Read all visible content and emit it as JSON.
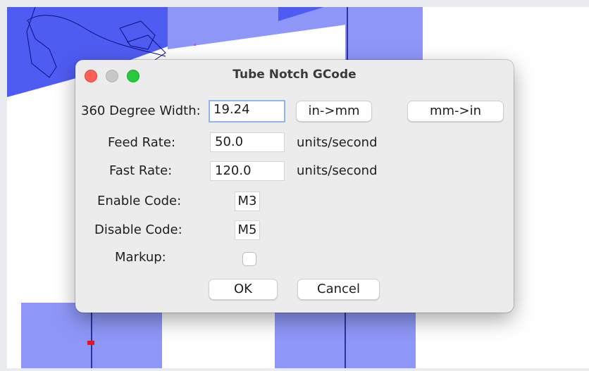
{
  "dialog": {
    "title": "Tube Notch GCode",
    "fields": {
      "width_label": "360 Degree Width:",
      "width_value": "19.24",
      "feed_label": "Feed Rate:",
      "feed_value": "50.0",
      "feed_unit": "units/second",
      "fast_label": "Fast Rate:",
      "fast_value": "120.0",
      "fast_unit": "units/second",
      "enable_label": "Enable Code:",
      "enable_value": "M3",
      "disable_label": "Disable Code:",
      "disable_value": "M5",
      "markup_label": "Markup:",
      "markup_checked": false
    },
    "buttons": {
      "in_to_mm": "in->mm",
      "mm_to_in": "mm->in",
      "ok": "OK",
      "cancel": "Cancel"
    }
  },
  "colors": {
    "shape_fill": "#8e97f7",
    "shape_fill_dark": "#4f5cf2",
    "line": "#0b1180",
    "marker": "#e3151f"
  }
}
